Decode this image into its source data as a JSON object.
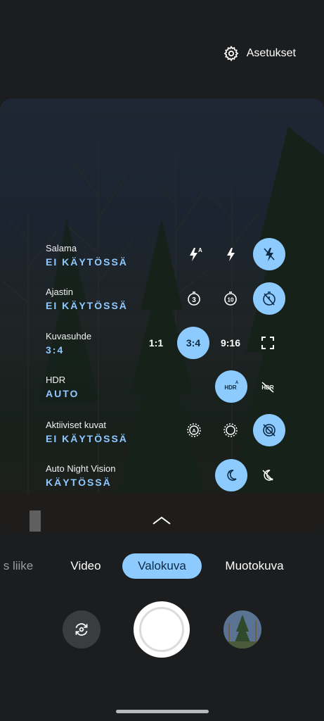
{
  "top": {
    "settings_label": "Asetukset",
    "settings_icon": "gear-icon"
  },
  "settings_rows": [
    {
      "label": "Salama",
      "value": "EI KÄYTÖSSÄ"
    },
    {
      "label": "Ajastin",
      "value": "EI KÄYTÖSSÄ"
    },
    {
      "label": "Kuvasuhde",
      "value": "3:4"
    },
    {
      "label": "HDR",
      "value": "AUTO"
    },
    {
      "label": "Aktiiviset kuvat",
      "value": "EI KÄYTÖSSÄ"
    },
    {
      "label": "Auto Night Vision",
      "value": "KÄYTÖSSÄ"
    }
  ],
  "aspect_options": [
    "1:1",
    "3:4",
    "9:16"
  ],
  "modes": [
    "s liike",
    "Video",
    "Valokuva",
    "Muotokuva"
  ],
  "selected_mode": "Valokuva",
  "colors": {
    "accent": "#8dcbff",
    "background": "#1b1d1f"
  }
}
